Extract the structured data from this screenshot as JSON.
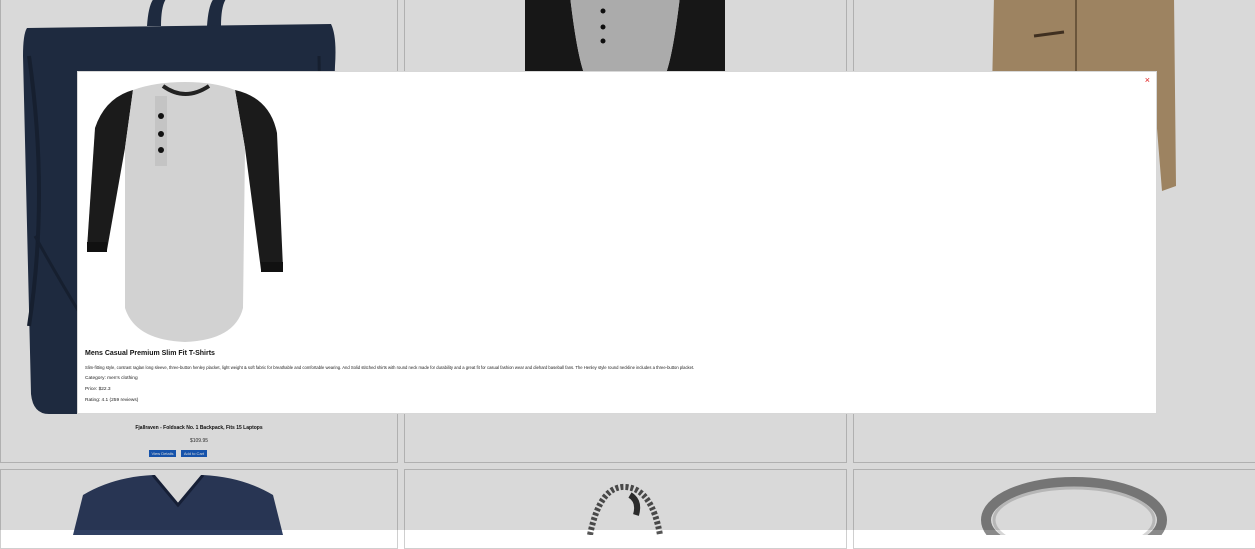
{
  "products": [
    {
      "title": "Fjallraven - Foldsack No. 1 Backpack, Fits 15 Laptops",
      "price": "$109.95"
    }
  ],
  "card_buttons": {
    "view_details": "View Details",
    "add_to_cart": "Add to Cart"
  },
  "modal": {
    "close_label": "×",
    "title": "Mens Casual Premium Slim Fit T-Shirts",
    "description": "Slim-fitting style, contrast raglan long sleeve, three-button henley placket, light weight & soft fabric for breathable and comfortable wearing. And Solid stitched shirts with round neck made for durability and a great fit for casual fashion wear and diehard baseball fans. The Henley style round neckline includes a three-button placket.",
    "category_line": "Category: men's clothing",
    "price_line": "Price: $22.3",
    "rating_line": "Rating: 4.1 (259 reviews)"
  },
  "colors": {
    "accent": "#1a62c9",
    "close": "#e01b1b"
  }
}
